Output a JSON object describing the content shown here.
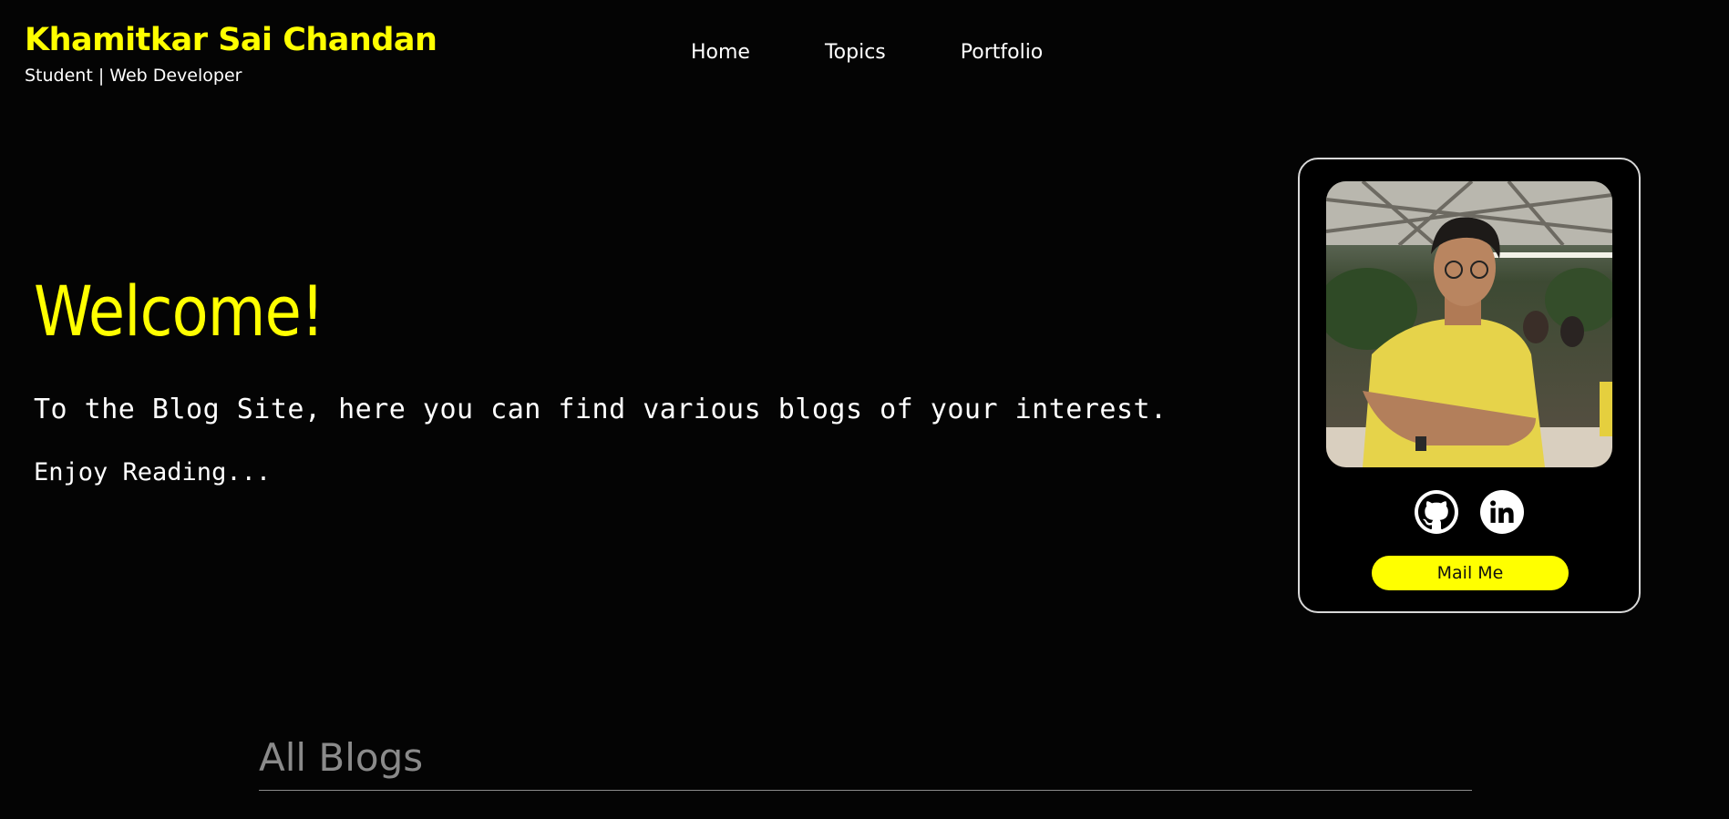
{
  "header": {
    "name": "Khamitkar Sai Chandan",
    "tagline": "Student | Web Developer",
    "nav": [
      "Home",
      "Topics",
      "Portfolio"
    ]
  },
  "hero": {
    "title": "Welcome!",
    "text": "To the Blog Site, here you can find various blogs of your interest.",
    "subtext": "Enjoy Reading..."
  },
  "profile_card": {
    "photo": "profile-photo",
    "socials": [
      "github-icon",
      "linkedin-icon"
    ],
    "mail_label": "Mail Me"
  },
  "blogs": {
    "section_title": "All Blogs"
  },
  "colors": {
    "accent": "#ffff00",
    "background": "#040404",
    "muted": "#8a8a8a"
  }
}
